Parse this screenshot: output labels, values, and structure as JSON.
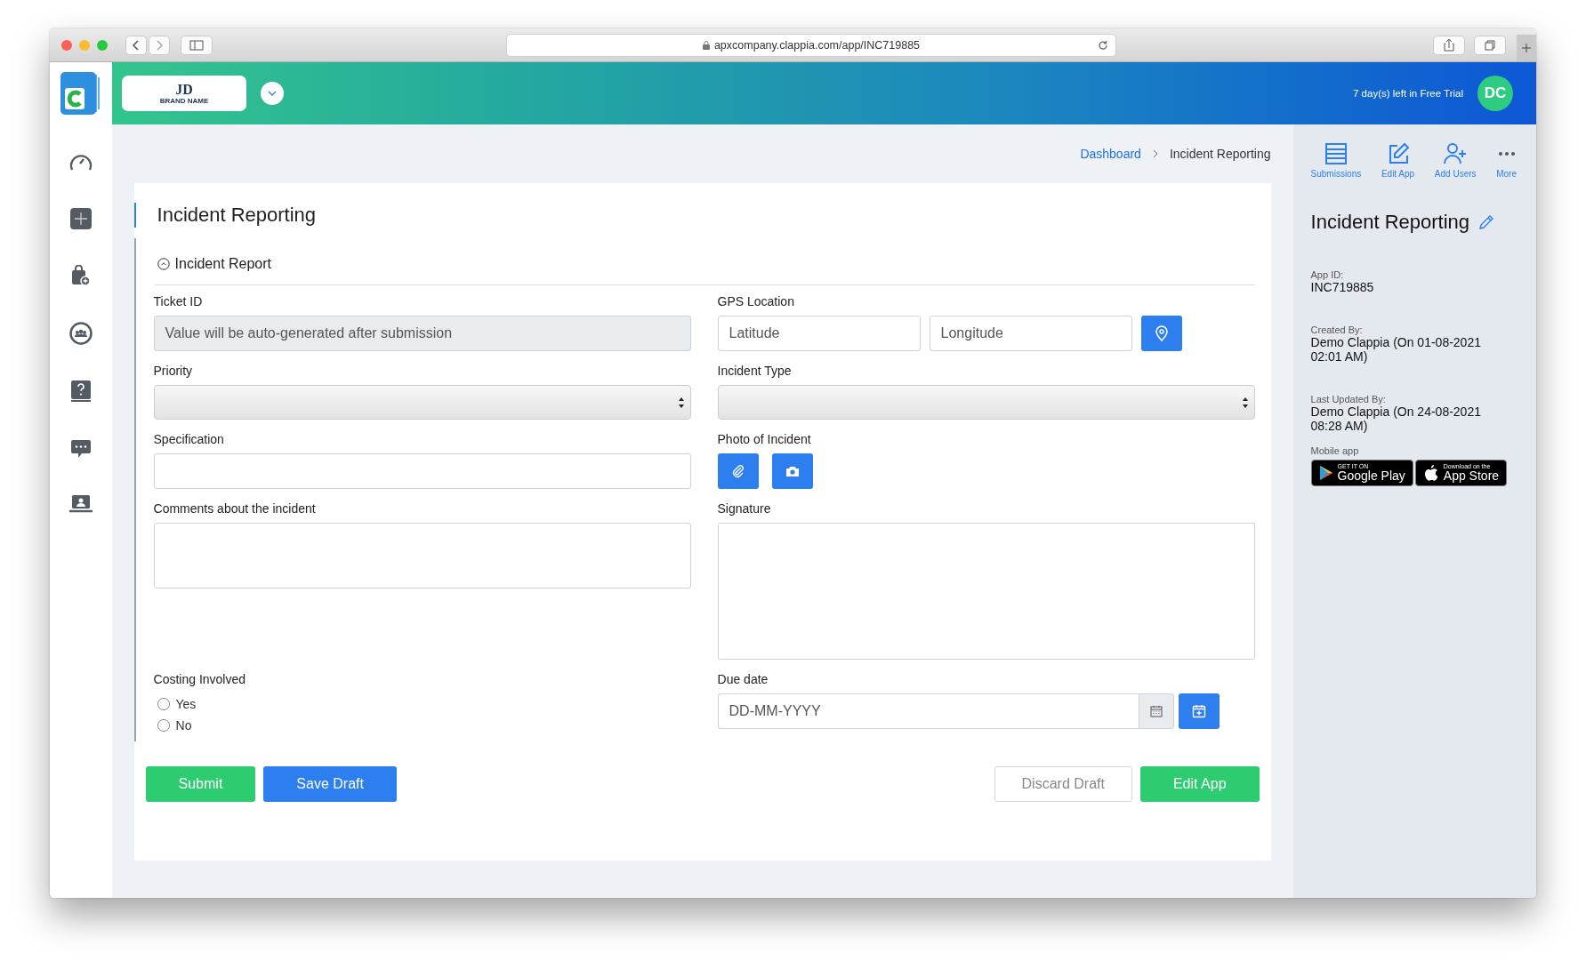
{
  "browser": {
    "url": "apxcompany.clappia.com/app/INC719885"
  },
  "header": {
    "brand_monogram": "JD",
    "brand_name": "BRAND NAME",
    "trial": "7 day(s) left in Free Trial",
    "avatar": "DC"
  },
  "breadcrumb": [
    {
      "label": "Dashboard",
      "kind": "link"
    },
    {
      "label": "Incident Reporting",
      "kind": "current"
    }
  ],
  "form": {
    "title": "Incident Reporting",
    "section": {
      "title": "Incident Report",
      "expanded": true
    },
    "fields": [
      {
        "kind": "readonly",
        "label": "Ticket ID",
        "placeholder": "Value will be auto-generated after submission"
      },
      {
        "kind": "gps",
        "label": "GPS Location",
        "placeholders": [
          "Latitude",
          "Longitude"
        ]
      },
      {
        "kind": "select",
        "label": "Priority"
      },
      {
        "kind": "select",
        "label": "Incident Type"
      },
      {
        "kind": "text",
        "label": "Specification"
      },
      {
        "kind": "file",
        "label": "Photo of Incident"
      },
      {
        "kind": "textarea",
        "label": "Comments about the incident"
      },
      {
        "kind": "signature",
        "label": "Signature"
      },
      {
        "kind": "radio",
        "label": "Costing Involved",
        "options": [
          {
            "label": "Yes",
            "selected": false
          },
          {
            "label": "No",
            "selected": false
          }
        ]
      },
      {
        "kind": "date",
        "label": "Due date",
        "placeholder": "DD-MM-YYYY"
      }
    ],
    "buttons": [
      {
        "label": "Submit",
        "kind": "submit"
      },
      {
        "label": "Save Draft",
        "kind": "save"
      },
      {
        "label": "Discard Draft",
        "kind": "discard"
      },
      {
        "label": "Edit App",
        "kind": "edit"
      }
    ]
  },
  "panel": {
    "actions": [
      {
        "label": "Submissions",
        "kind": "list"
      },
      {
        "label": "Edit App",
        "kind": "edit"
      },
      {
        "label": "Add Users",
        "kind": "users"
      },
      {
        "label": "More",
        "kind": "more"
      }
    ],
    "title": "Incident Reporting",
    "info": [
      {
        "label": "App ID:",
        "value": "INC719885"
      },
      {
        "label": "Created By:",
        "value": "Demo Clappia (On 01-08-2021 02:01 AM)"
      },
      {
        "label": "Last Updated By:",
        "value": "Demo Clappia (On 24-08-2021 08:28 AM)"
      }
    ],
    "mobile_label": "Mobile app",
    "stores": [
      {
        "kind": "google",
        "small": "GET IT ON",
        "big": "Google Play"
      },
      {
        "kind": "apple",
        "small": "Download on the",
        "big": "App Store"
      }
    ]
  }
}
